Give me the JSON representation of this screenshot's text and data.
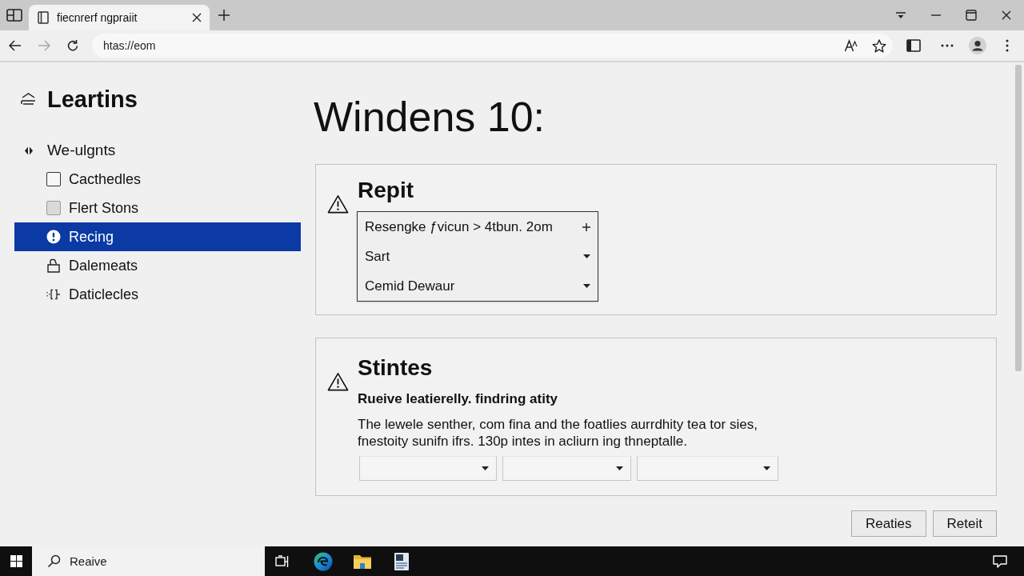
{
  "browser": {
    "tabs": [
      {
        "title": "fiecnrerf ngpraiit",
        "selected": true
      }
    ],
    "back": {
      "disabled": false
    },
    "forward": {
      "disabled": true
    },
    "address": {
      "value": "htas://eom"
    }
  },
  "sidebar": {
    "title": "Leartins",
    "items": [
      {
        "label": "We-ulgnts",
        "selected": false,
        "children": [
          {
            "kind": "checkbox",
            "label": "Cacthedles",
            "checked": false,
            "disabled": false,
            "selected": false
          },
          {
            "kind": "checkbox",
            "label": "Flert Stons",
            "checked": false,
            "disabled": true,
            "selected": false
          },
          {
            "kind": "icon",
            "label": "Recing",
            "selected": true
          },
          {
            "kind": "icon",
            "label": "Dalemeats",
            "selected": false
          },
          {
            "kind": "icon",
            "label": "Daticlecles",
            "selected": false
          }
        ]
      }
    ]
  },
  "page": {
    "title": "Windens 10:"
  },
  "panels": [
    {
      "kind": "list",
      "title": "Repit",
      "rows": [
        {
          "kind": "expand",
          "value": "Resengke ƒvicun > 4tbun. 2om",
          "expanded": false
        },
        {
          "kind": "dropdown",
          "value": "Sart",
          "expanded": false
        },
        {
          "kind": "dropdown",
          "value": "Cemid Dewaur",
          "expanded": false
        }
      ]
    },
    {
      "kind": "text",
      "title": "Stintes",
      "subtitle": "Rueive leatierelly. findring atity",
      "body": "The lewele senther, com fina and the foatlies aurrdhity tea tor sies,\nfnestoity sunifn ifrs. 130p intes in acliurn ing thneptalle.",
      "dropdowns": [
        {
          "expanded": false
        },
        {
          "expanded": false
        },
        {
          "expanded": false
        }
      ]
    }
  ],
  "buttons": [
    {
      "label": "Reaties"
    },
    {
      "label": "Reteit"
    }
  ],
  "taskbar": {
    "search": {
      "placeholder": "Reaive"
    }
  }
}
